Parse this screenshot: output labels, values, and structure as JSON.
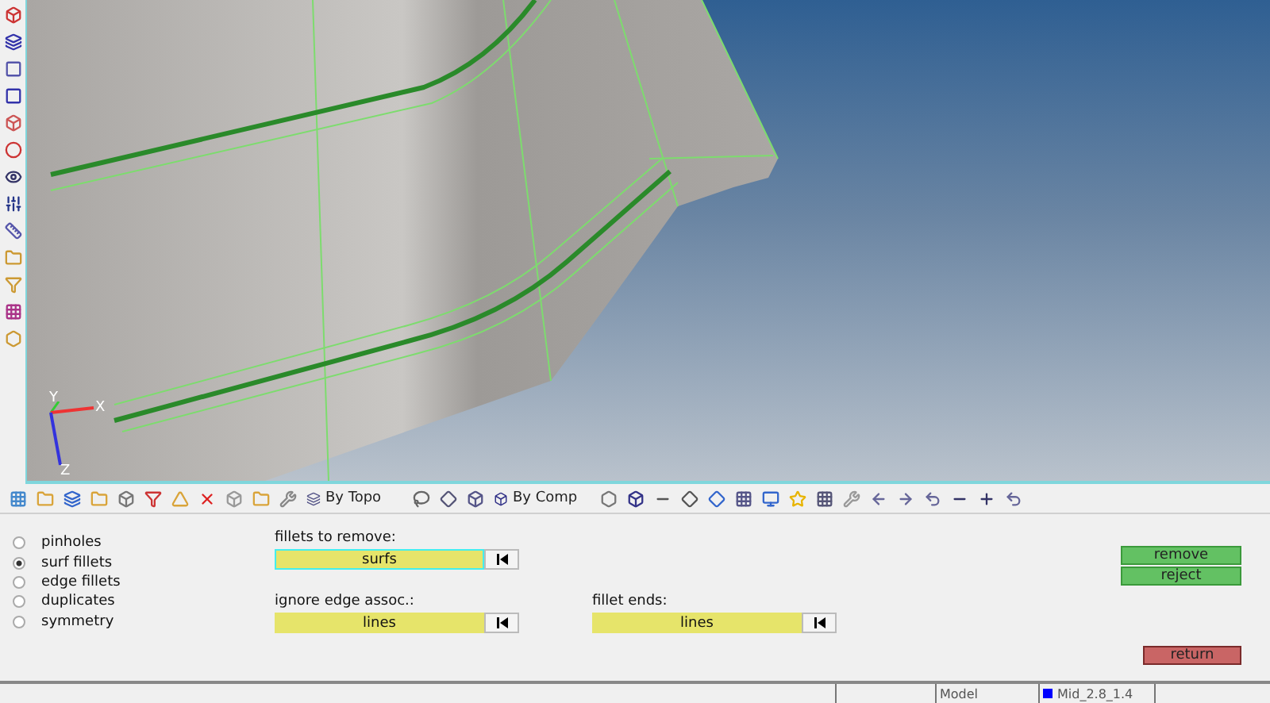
{
  "viewport": {
    "axes": [
      {
        "label": "Y"
      },
      {
        "label": "X"
      },
      {
        "label": "Z"
      }
    ]
  },
  "toolbar": {
    "dropdowns": [
      {
        "label": "By Topo"
      },
      {
        "label": "By Comp"
      }
    ]
  },
  "panel": {
    "options": [
      {
        "label": "pinholes",
        "selected": false
      },
      {
        "label": "surf fillets",
        "selected": true
      },
      {
        "label": "edge fillets",
        "selected": false
      },
      {
        "label": "duplicates",
        "selected": false
      },
      {
        "label": "symmetry",
        "selected": false
      }
    ],
    "selectors": [
      {
        "label": "fillets to remove:",
        "value": "surfs",
        "active": true
      },
      {
        "label": "ignore edge assoc.:",
        "value": "lines",
        "active": false
      },
      {
        "label": "fillet ends:",
        "value": "lines",
        "active": false
      }
    ],
    "buttons": [
      {
        "label": "remove",
        "kind": "action"
      },
      {
        "label": "reject",
        "kind": "action"
      },
      {
        "label": "return",
        "kind": "exit"
      }
    ]
  },
  "status_bar": {
    "model": "Model",
    "component": {
      "name": "Mid_2.8_1.4",
      "color": "#0000ff"
    }
  }
}
